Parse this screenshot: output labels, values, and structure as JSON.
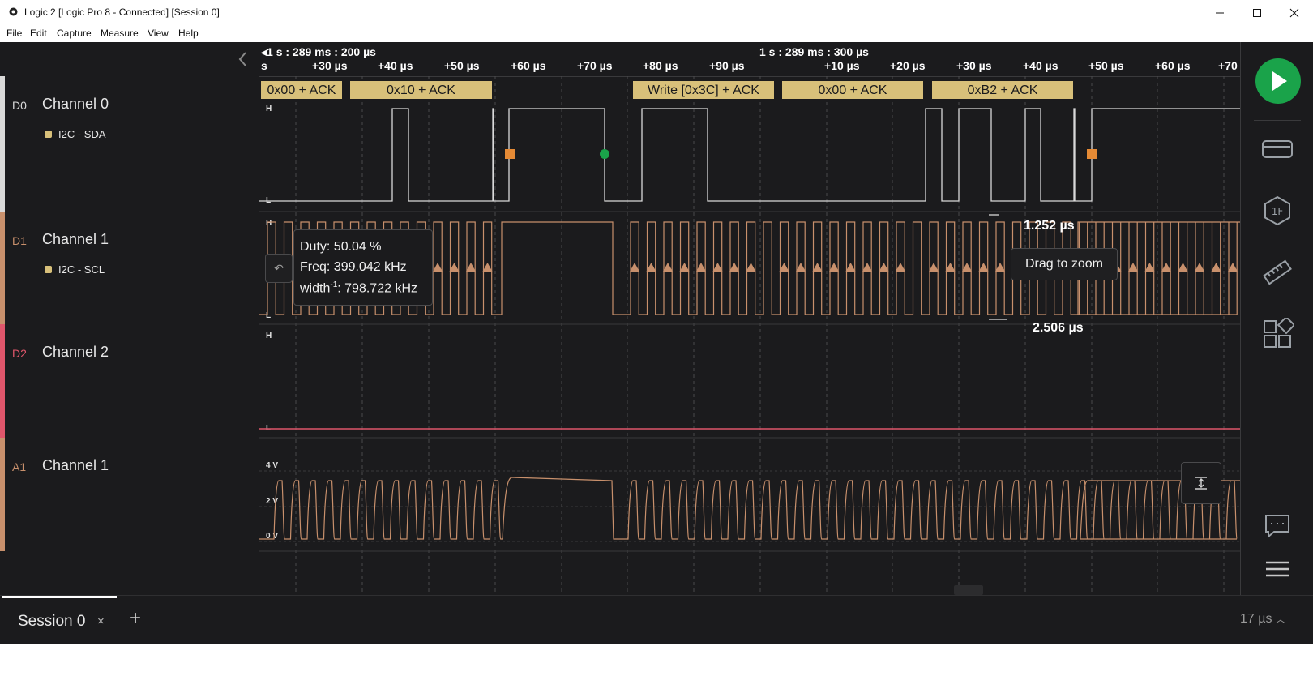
{
  "window": {
    "title": "Logic 2 [Logic Pro 8 - Connected] [Session 0]"
  },
  "menu": [
    "File",
    "Edit",
    "Capture",
    "Measure",
    "View",
    "Help"
  ],
  "timeline": {
    "group_left": "1 s : 289 ms : 200 µs",
    "group_right": "1 s : 289 ms : 300 µs",
    "ticks": [
      "s",
      "+30 µs",
      "+40 µs",
      "+50 µs",
      "+60 µs",
      "+70 µs",
      "+80 µs",
      "+90 µs",
      "+10 µs",
      "+20 µs",
      "+30 µs",
      "+40 µs",
      "+50 µs",
      "+60 µs",
      "+70"
    ]
  },
  "channels": [
    {
      "tag": "D0",
      "name": "Channel 0",
      "analyzer": "I2C - SDA",
      "color": "#d9d9d9"
    },
    {
      "tag": "D1",
      "name": "Channel 1",
      "analyzer": "I2C - SCL",
      "color": "#c8906c"
    },
    {
      "tag": "D2",
      "name": "Channel 2",
      "analyzer": "",
      "color": "#e0566b"
    },
    {
      "tag": "A1",
      "name": "Channel 1",
      "analyzer": "",
      "color": "#c8906c"
    }
  ],
  "level_labels": {
    "high": "H",
    "low": "L"
  },
  "analog_labels": [
    "4 V",
    "2 V",
    "0 V"
  ],
  "i2c_frames": [
    "0x00 + ACK",
    "0x10 + ACK",
    "Write [0x3C] + ACK",
    "0x00 + ACK",
    "0xB2 + ACK"
  ],
  "tooltip": {
    "duty": "Duty: 50.04 %",
    "freq": "Freq: 399.042 kHz",
    "width_prefix": "width",
    "width_sup": "-1",
    "width_value": ": 798.722 kHz"
  },
  "measurements": {
    "pulse_width": "1.252 µs",
    "period": "2.506 µs"
  },
  "drag_hint": "Drag to zoom",
  "session": {
    "tab_label": "Session 0",
    "close": "×",
    "add": "+"
  },
  "zoom_level": "17 µs",
  "colors": {
    "sda": "#d9d9d9",
    "scl": "#c8906c",
    "ch2": "#e0566b",
    "frame_bg": "#d8c07a",
    "start_marker": "#1aa34a",
    "stop_marker": "#e58a35",
    "play": "#1aa34a"
  },
  "icons": [
    "settings-gear-icon",
    "minimize-icon",
    "maximize-icon",
    "close-icon",
    "chevron-left-icon",
    "play-icon",
    "device-icon",
    "analyzers-icon",
    "measurement-ruler-icon",
    "extensions-icon",
    "feedback-chat-icon",
    "hamburger-menu-icon",
    "undo-icon",
    "autoscale-icon",
    "chevron-up-icon"
  ]
}
